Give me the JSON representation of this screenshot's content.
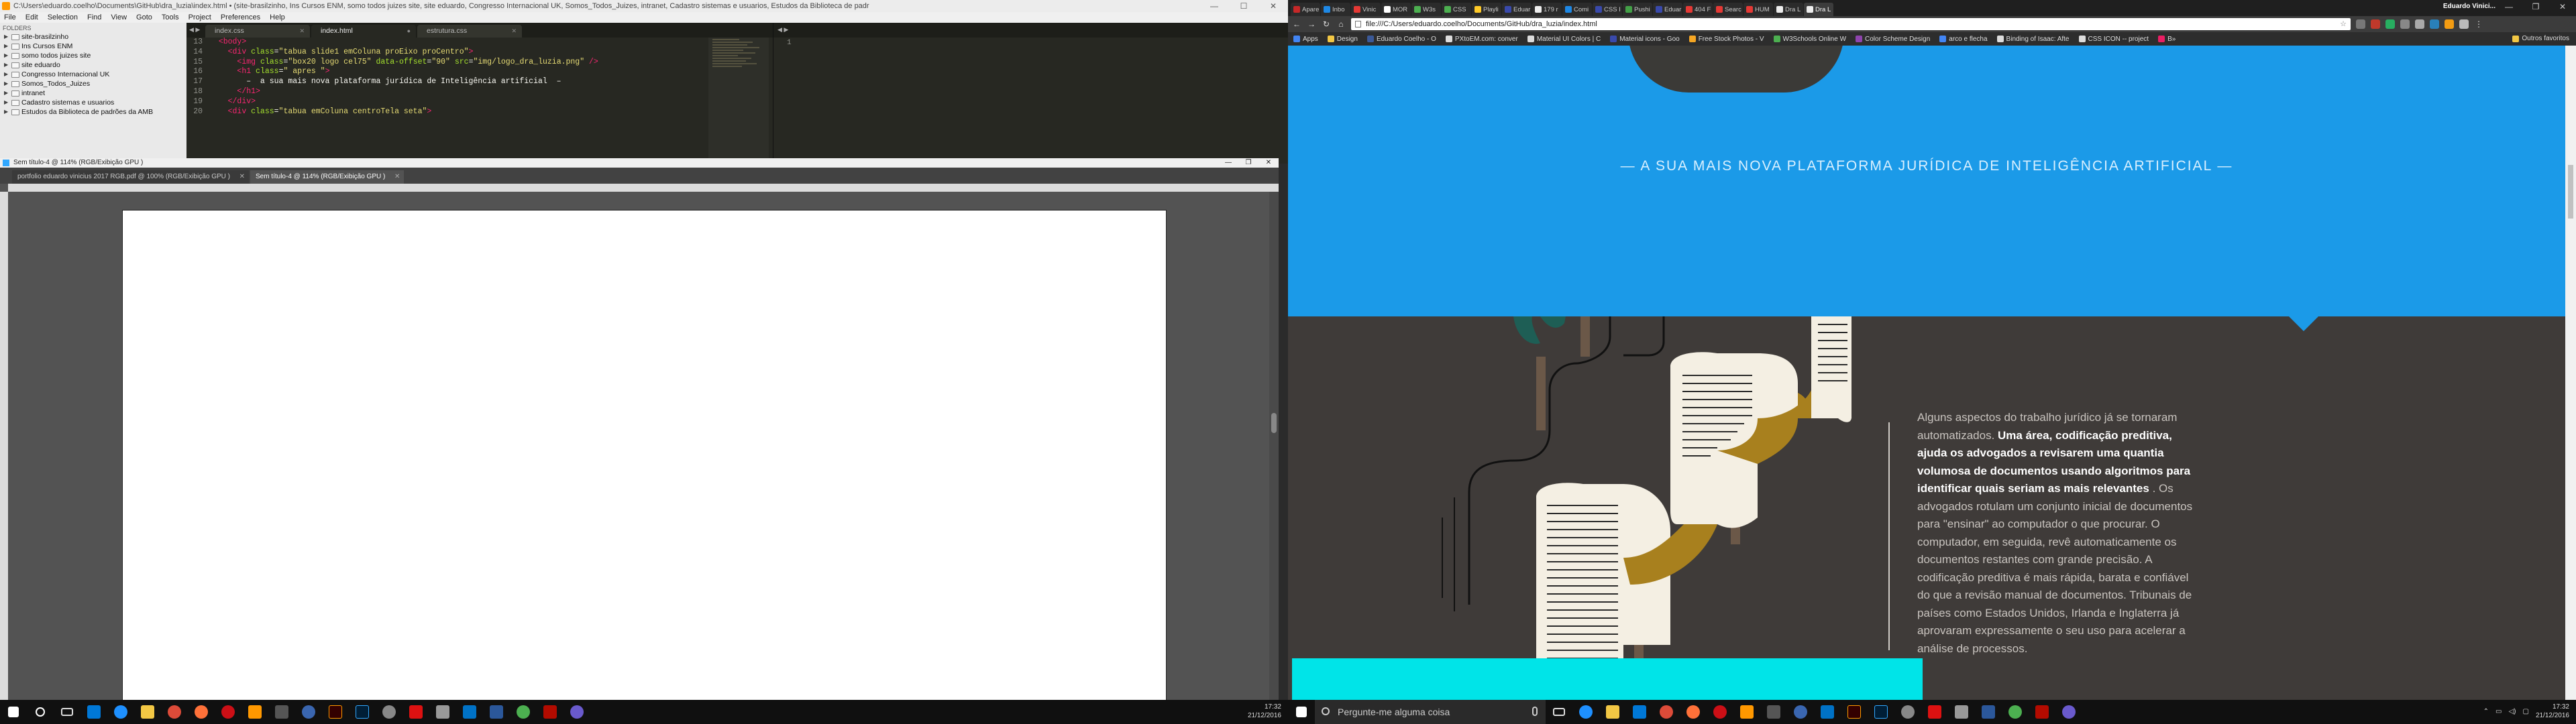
{
  "left": {
    "sublime": {
      "title": "C:\\Users\\eduardo.coelho\\Documents\\GitHub\\dra_luzia\\index.html • (site-brasilzinho, Ins Cursos ENM, somo todos juizes site, site eduardo, Congresso Internacional UK, Somos_Todos_Juizes, intranet, Cadastro sistemas e usuarios, Estudos da Biblioteca de padr",
      "menu": [
        "File",
        "Edit",
        "Selection",
        "Find",
        "View",
        "Goto",
        "Tools",
        "Project",
        "Preferences",
        "Help"
      ],
      "folders_label": "FOLDERS",
      "folders": [
        "site-brasilzinho",
        "Ins Cursos ENM",
        "somo todos juizes site",
        "site eduardo",
        "Congresso Internacional UK",
        "Somos_Todos_Juizes",
        "intranet",
        "Cadastro sistemas e usuarios",
        "Estudos da Biblioteca de padrões da AMB"
      ],
      "tabs": [
        {
          "label": "index.css"
        },
        {
          "label": "index.html"
        },
        {
          "label": "estrutura.css"
        }
      ],
      "line_numbers": [
        "13",
        "14",
        "15",
        "16",
        "17",
        "18",
        "19",
        "20"
      ],
      "right_pane_line": "1"
    },
    "photoshop": {
      "title": "Sem título-4 @ 114% (RGB/Exibição GPU )",
      "tabs": [
        {
          "label": "portfolio eduardo vinicius 2017 RGB.pdf @ 100% (RGB/Exibição GPU )"
        },
        {
          "label": "Sem título-4 @ 114% (RGB/Exibição GPU )"
        }
      ]
    },
    "taskbar": {
      "time": "17:32",
      "date": "21/12/2016"
    }
  },
  "right": {
    "chrome": {
      "tabs": [
        "Apare",
        "Inbo",
        "Vinic",
        "MOR",
        "W3s",
        "CSS",
        "Playli",
        "Eduar",
        "179 r",
        "Comi",
        "CSS I",
        "Pushi",
        "Eduar",
        "404 F",
        "Searc",
        "HUM",
        "Dra L",
        "Dra L"
      ],
      "user": "Eduardo Vinici...",
      "url": "file:///C:/Users/eduardo.coelho/Documents/GitHub/dra_luzia/index.html",
      "bookmarks": [
        "Apps",
        "Design",
        "Eduardo Coelho - O",
        "PXtoEM.com: conver",
        "Material UI Colors | C",
        "Material icons - Goo",
        "Free Stock Photos - V",
        "W3Schools Online W",
        "Color Scheme Design",
        "arco e flecha",
        "Binding of Isaac: Afte",
        "CSS ICON -- project",
        "B»"
      ],
      "other_bookmarks": "Outros favoritos"
    },
    "page": {
      "tagline": "— A SUA MAIS NOVA PLATAFORMA JURÍDICA DE INTELIGÊNCIA ARTIFICIAL —",
      "para_intro": "Alguns aspectos do trabalho jurídico já se tornaram automatizados. ",
      "para_bold": "Uma área, codificação preditiva, ajuda os advogados a revisarem uma quantia volumosa de documentos usando algoritmos para identificar quais seriam as mais relevantes",
      "para_rest": " . Os advogados rotulam um conjunto inicial de documentos para \"ensinar\" ao computador o que procurar. O computador, em seguida, revê automaticamente os documentos restantes com grande precisão. A codificação preditiva é mais rápida, barata e confiável do que a revisão manual de documentos. Tribunais de países como Estados Unidos, Irlanda e Inglaterra já aprovaram expressamente o seu uso para acelerar a análise de processos.",
      "colors": {
        "sky": "#1b9ae8",
        "dark": "#3f3b39",
        "cyan": "#00e4e8",
        "paper": "#f4efe3",
        "gold": "#a8801e"
      }
    },
    "taskbar": {
      "search_placeholder": "Pergunte-me alguma coisa",
      "time": "17:32",
      "date": "21/12/2016"
    }
  }
}
